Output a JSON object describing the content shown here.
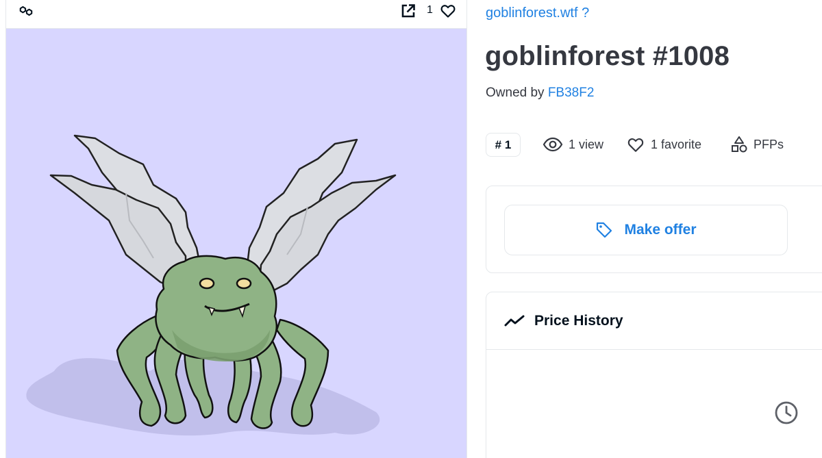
{
  "art": {
    "favorite_count": "1",
    "background_color": "#d8d6ff",
    "icons": {
      "chain": "polygon-link-icon",
      "external": "external-link-icon",
      "favorite": "heart-outline-icon"
    },
    "image_subject": "goblinforest-creature-art"
  },
  "collection": {
    "name": "goblinforest.wtf ?"
  },
  "asset": {
    "title": "goblinforest #1008"
  },
  "owner": {
    "prefix": "Owned by",
    "name": "FB38F2"
  },
  "stats": {
    "rank": "# 1",
    "views": "1 view",
    "favorites": "1 favorite",
    "category": "PFPs",
    "icons": {
      "views": "eye-icon",
      "favorites": "heart-outline-icon",
      "category": "shapes-icon"
    }
  },
  "offer": {
    "button_label": "Make offer",
    "icon": "tag-icon"
  },
  "price_history": {
    "title": "Price History",
    "header_icon": "trend-line-icon",
    "empty_icon": "clock-icon"
  },
  "colors": {
    "accent": "#2081e2",
    "text": "#353840",
    "border": "#e5e8eb"
  }
}
